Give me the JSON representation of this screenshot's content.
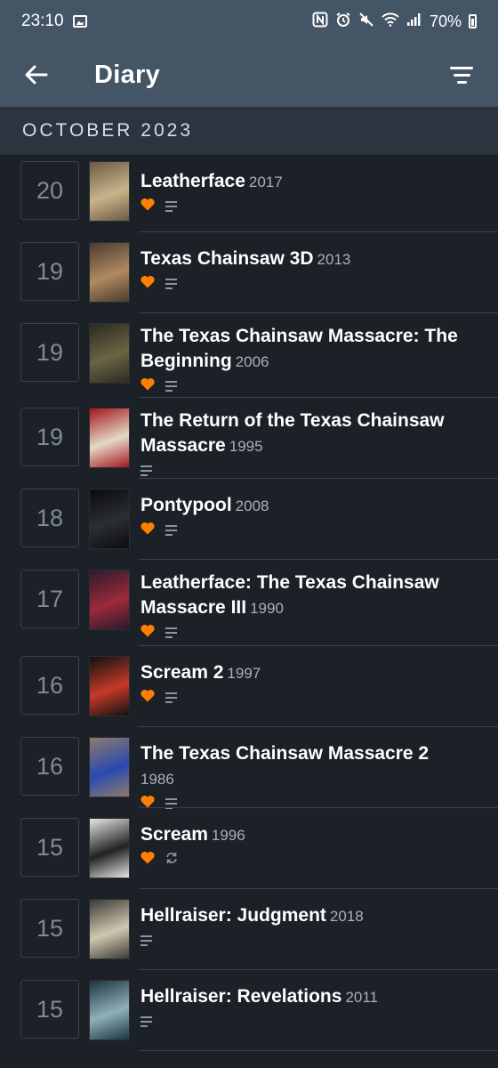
{
  "status_bar": {
    "time": "23:10",
    "battery": "70%"
  },
  "app_bar": {
    "title": "Diary"
  },
  "month_header": "OCTOBER 2023",
  "entries": [
    {
      "day": "20",
      "title": "Leatherface",
      "year": "2017",
      "liked": true,
      "review": true,
      "rewatch": false,
      "poster_colors": [
        "#6b5a45",
        "#c9b48a"
      ]
    },
    {
      "day": "19",
      "title": "Texas Chainsaw 3D",
      "year": "2013",
      "liked": true,
      "review": true,
      "rewatch": false,
      "poster_colors": [
        "#4a3b2e",
        "#b08a62"
      ]
    },
    {
      "day": "19",
      "title": "The Texas Chainsaw Massacre: The Beginning",
      "year": "2006",
      "liked": true,
      "review": true,
      "rewatch": false,
      "poster_colors": [
        "#2b2a22",
        "#6a6444"
      ]
    },
    {
      "day": "19",
      "title": "The Return of the Texas Chainsaw Massacre",
      "year": "1995",
      "liked": false,
      "review": true,
      "rewatch": false,
      "poster_colors": [
        "#a5141b",
        "#e3d9c8"
      ]
    },
    {
      "day": "18",
      "title": "Pontypool",
      "year": "2008",
      "liked": true,
      "review": true,
      "rewatch": false,
      "poster_colors": [
        "#0b0c0e",
        "#2b2e33"
      ]
    },
    {
      "day": "17",
      "title": "Leatherface: The Texas Chainsaw Massacre III",
      "year": "1990",
      "liked": true,
      "review": true,
      "rewatch": false,
      "poster_colors": [
        "#2c1a2e",
        "#9c2a3a"
      ]
    },
    {
      "day": "16",
      "title": "Scream 2",
      "year": "1997",
      "liked": true,
      "review": true,
      "rewatch": false,
      "poster_colors": [
        "#101010",
        "#c53a2a"
      ]
    },
    {
      "day": "16",
      "title": "The Texas Chainsaw Massacre 2",
      "year": "1986",
      "liked": true,
      "review": true,
      "rewatch": false,
      "poster_colors": [
        "#8c7c6a",
        "#2a4ab0"
      ]
    },
    {
      "day": "15",
      "title": "Scream",
      "year": "1996",
      "liked": true,
      "review": false,
      "rewatch": true,
      "poster_colors": [
        "#e6e6e6",
        "#222222"
      ]
    },
    {
      "day": "15",
      "title": "Hellraiser: Judgment",
      "year": "2018",
      "liked": false,
      "review": true,
      "rewatch": false,
      "poster_colors": [
        "#3b3a35",
        "#cfc7b0"
      ]
    },
    {
      "day": "15",
      "title": "Hellraiser: Revelations",
      "year": "2011",
      "liked": false,
      "review": true,
      "rewatch": false,
      "poster_colors": [
        "#1d3540",
        "#8fb0b8"
      ]
    }
  ],
  "colors": {
    "heart": "#ff8000",
    "app_bar": "#445566",
    "background": "#1c2027"
  }
}
